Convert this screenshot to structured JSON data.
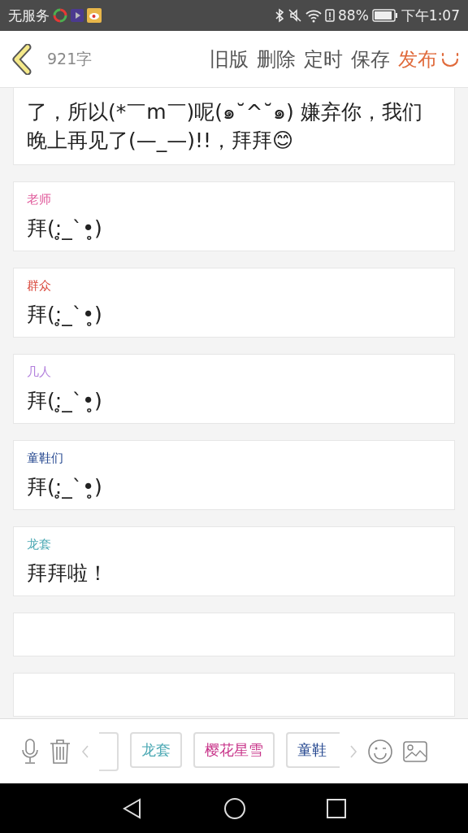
{
  "status_bar": {
    "carrier": "无服务",
    "battery": "88%",
    "time": "下午1:07"
  },
  "header": {
    "word_count": "921字",
    "actions": [
      {
        "label": "旧版",
        "kind": "plain"
      },
      {
        "label": "删除",
        "kind": "plain"
      },
      {
        "label": "定时",
        "kind": "plain"
      },
      {
        "label": "保存",
        "kind": "plain"
      },
      {
        "label": "发布",
        "kind": "publish"
      }
    ]
  },
  "intro_text": "了，所以(*￣m￣)呢(๑˘^˘๑) 嫌弃你，我们晚上再见了(—_—)!!，拜拜😊",
  "lines": [
    {
      "speaker": "老师",
      "color": "#e0589a",
      "text": "拜(:̥_`•̥)"
    },
    {
      "speaker": "群众",
      "color": "#d9463a",
      "text": "拜(:̥_`•̥)"
    },
    {
      "speaker": "几人",
      "color": "#b27fdc",
      "text": "拜(:̥_`•̥)"
    },
    {
      "speaker": "童鞋们",
      "color": "#23468f",
      "text": "拜(:̥_`•̥)"
    },
    {
      "speaker": "龙套",
      "color": "#4aa8b3",
      "text": "拜拜啦！"
    }
  ],
  "blank_cards": [
    {
      "kind": "empty"
    },
    {
      "kind": "empty"
    }
  ],
  "role_chips": [
    {
      "kind": "stub"
    },
    {
      "label": "龙套",
      "color": "#4aa8b3"
    },
    {
      "label": "樱花星雪",
      "color": "#c8358a"
    },
    {
      "label": "童鞋",
      "color": "#23468f"
    }
  ]
}
